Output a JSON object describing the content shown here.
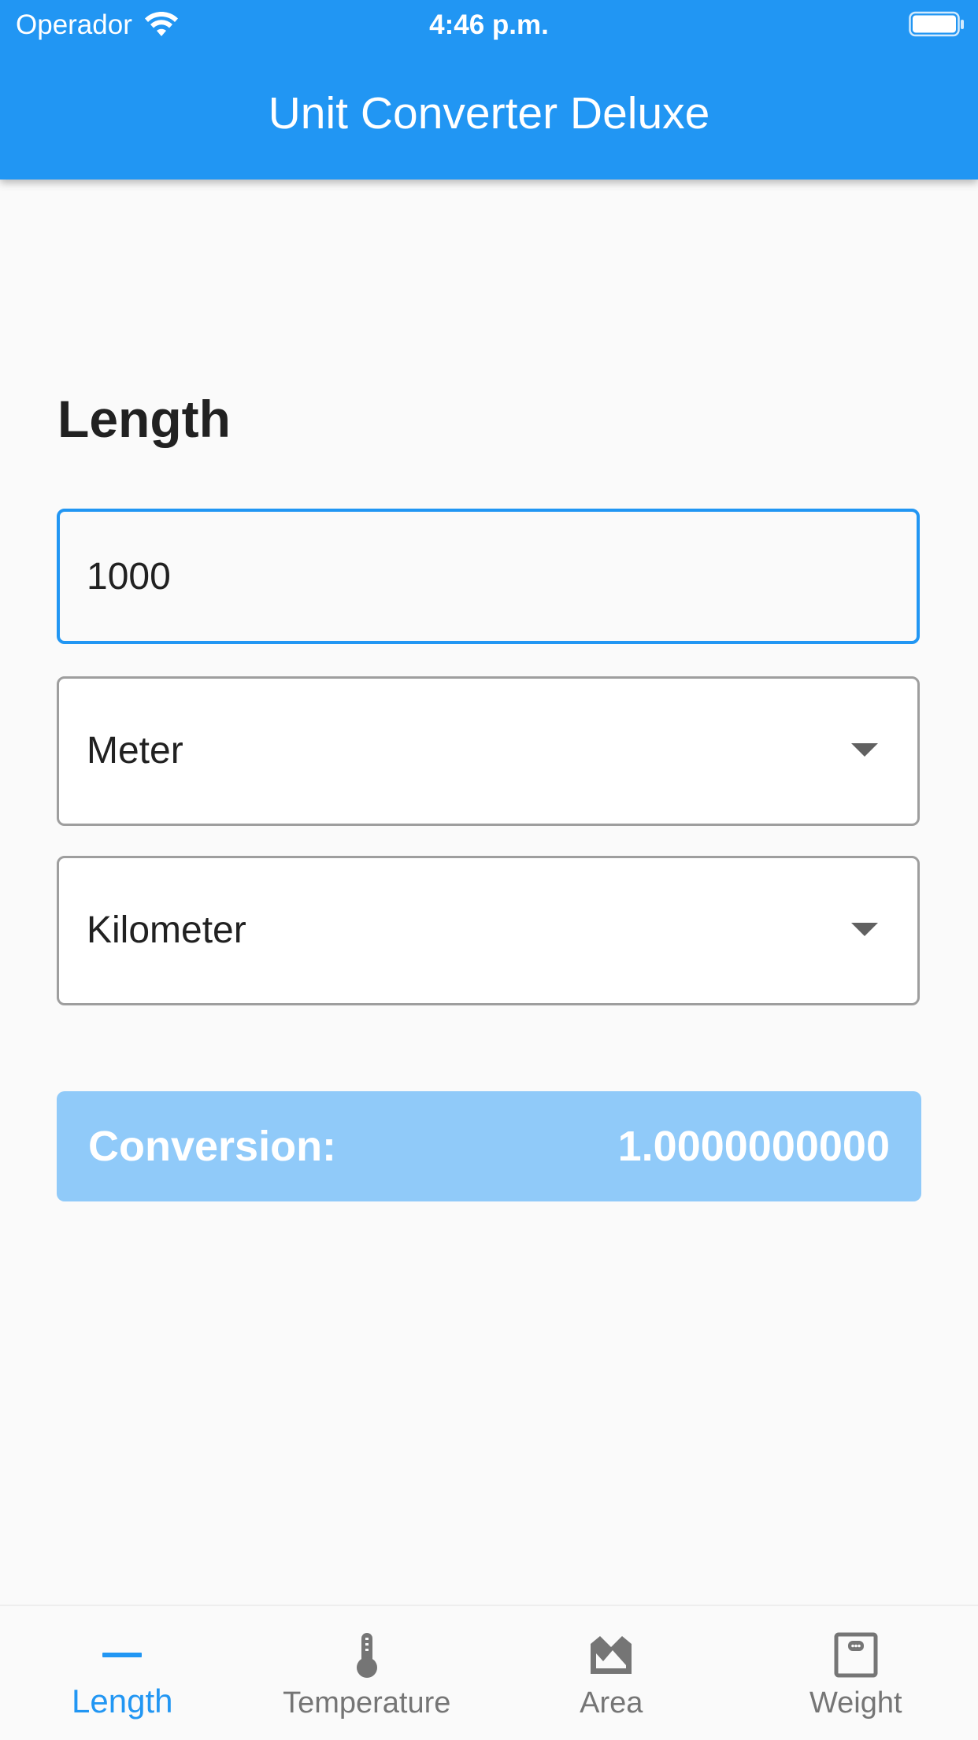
{
  "status_bar": {
    "carrier": "Operador",
    "time": "4:46 p.m."
  },
  "app_bar": {
    "title": "Unit Converter Deluxe",
    "color": "#2196f3"
  },
  "converter": {
    "category_title": "Length",
    "input_value": "1000",
    "from_unit": "Meter",
    "to_unit": "Kilometer",
    "result_label": "Conversion:",
    "result_value": "1.0000000000"
  },
  "bottom_nav": {
    "items": [
      {
        "label": "Length",
        "icon": "ruler-icon",
        "active": true
      },
      {
        "label": "Temperature",
        "icon": "thermometer-icon",
        "active": false
      },
      {
        "label": "Area",
        "icon": "area-icon",
        "active": false
      },
      {
        "label": "Weight",
        "icon": "weight-icon",
        "active": false
      }
    ]
  },
  "colors": {
    "accent": "#2196f3",
    "result_background": "#90caf9",
    "inactive": "#757575"
  }
}
